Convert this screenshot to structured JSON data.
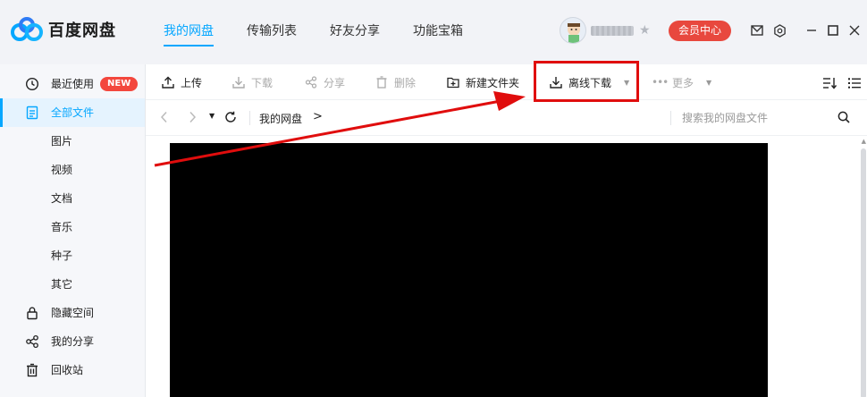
{
  "app": {
    "name": "百度网盘",
    "accent": "#06a7ff",
    "highlight_color": "#e00d0d"
  },
  "nav": {
    "tabs": [
      {
        "label": "我的网盘"
      },
      {
        "label": "传输列表"
      },
      {
        "label": "好友分享"
      },
      {
        "label": "功能宝箱"
      }
    ]
  },
  "header": {
    "member_button": "会员中心",
    "icons": [
      "mail-icon",
      "settings-icon",
      "minimize-icon",
      "maximize-icon",
      "close-icon"
    ]
  },
  "sidebar": {
    "items": [
      {
        "label": "最近使用",
        "icon": "clock-icon",
        "badge": "NEW"
      },
      {
        "label": "全部文件",
        "icon": "file-icon",
        "active": true
      },
      {
        "label": "图片"
      },
      {
        "label": "视频"
      },
      {
        "label": "文档"
      },
      {
        "label": "音乐"
      },
      {
        "label": "种子"
      },
      {
        "label": "其它"
      },
      {
        "label": "隐藏空间",
        "icon": "lock-icon"
      },
      {
        "label": "我的分享",
        "icon": "share-icon"
      },
      {
        "label": "回收站",
        "icon": "trash-icon"
      }
    ]
  },
  "toolbar": {
    "upload": "上传",
    "download": "下载",
    "share": "分享",
    "delete": "删除",
    "new_folder": "新建文件夹",
    "offline_download": "离线下载",
    "more": "更多"
  },
  "address": {
    "breadcrumb": "我的网盘",
    "separator": ">",
    "search_placeholder": "搜索我的网盘文件"
  }
}
